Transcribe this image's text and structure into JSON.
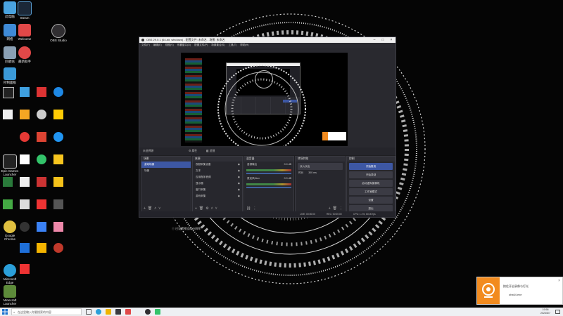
{
  "desktop_icons": [
    {
      "label": "此电脑",
      "color": "#4aa3df"
    },
    {
      "label": "Steam",
      "color": "#1b2838"
    },
    {
      "label": "OBS Studio",
      "color": "#302e31"
    },
    {
      "label": "网络",
      "color": "#3f8ad6"
    },
    {
      "label": "Welcome",
      "color": "#e04848"
    },
    {
      "label": "回收站",
      "color": "#8aa0b4"
    },
    {
      "label": "最新助手",
      "color": "#e04848"
    },
    {
      "label": "控制面板",
      "color": "#3b9ad9"
    },
    {
      "label": "Epic Games Launcher",
      "color": "#222"
    },
    {
      "label": "Microsoft Edge",
      "color": "#2b9fd9"
    },
    {
      "label": "Google Chrome",
      "color": "#e0c040"
    },
    {
      "label": "Minecraft Launcher",
      "color": "#5d8b3a"
    }
  ],
  "obs": {
    "title": "OBS 29.0.1 (64-bit, windows) - 配置文件: 未命名 - 场景: 未命名",
    "menu": [
      "文件(F)",
      "编辑(E)",
      "视图(V)",
      "停靠窗口(D)",
      "配置文件(P)",
      "场景集合(S)",
      "工具(T)",
      "帮助(H)"
    ],
    "controls_strip": {
      "label": "未选择源",
      "properties": "属性",
      "filters": "滤镜"
    },
    "scenes": {
      "title": "场景",
      "items": [
        "游戏场景",
        "场景"
      ]
    },
    "sources": {
      "title": "来源",
      "items": [
        "视频采集设备",
        "文本",
        "应用程序音频",
        "显示器",
        "窗口采集",
        "游戏采集"
      ]
    },
    "mixer": {
      "title": "混音器",
      "channels": [
        {
          "name": "音频输出",
          "level": "0.0 dB"
        },
        {
          "name": "麦克风/Aux",
          "level": "0.0 dB"
        }
      ]
    },
    "transitions": {
      "title": "转场特效",
      "type": "淡入淡出",
      "duration_label": "时长",
      "duration": "300 ms"
    },
    "controls": {
      "title": "控制",
      "buttons": [
        "开始推流",
        "开始录制",
        "启动虚拟摄像机",
        "工作室模式",
        "设置",
        "退出"
      ]
    },
    "status": {
      "live": "LIVE: 00:00:00",
      "rec": "REC: 00:00:00",
      "cpu": "CPU: 1.1%, 60.00 fps"
    }
  },
  "overlay": {
    "text": "已设置预设的分辨率"
  },
  "taskbar": {
    "search_placeholder": "在这里输入你要搜索的内容",
    "time": "19:56",
    "date": "2023/6/7"
  },
  "toast": {
    "title": "按住开启录像与灯光",
    "subtitle": "obs64.exe",
    "close": "×"
  }
}
